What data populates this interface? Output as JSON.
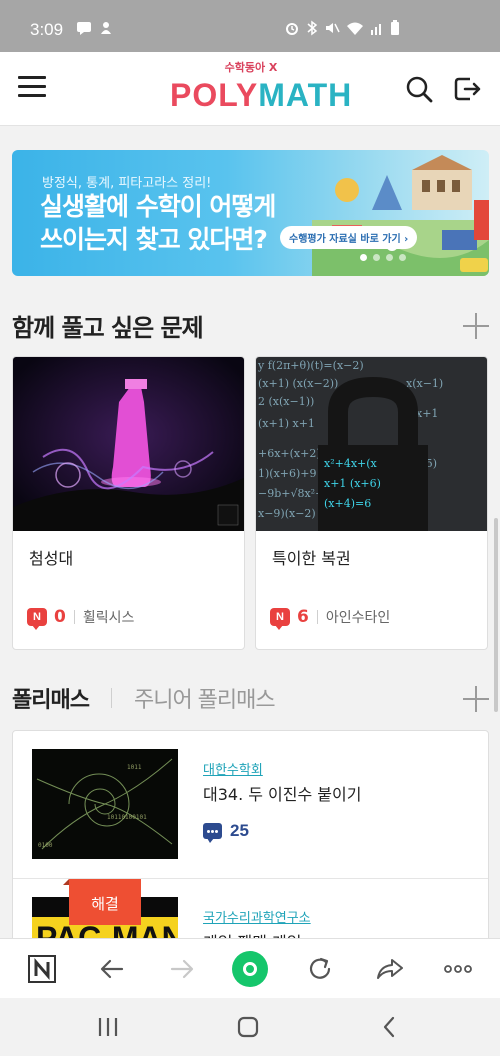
{
  "status_bar": {
    "time": "3:09"
  },
  "header": {
    "logo_sub": "수학동아 X",
    "logo_poly": "POLY",
    "logo_math": "MATH"
  },
  "banner": {
    "kicker": "방정식, 통계, 피타고라스 정리!",
    "title_line1": "실생활에 수학이 어떻게",
    "title_line2": "쓰이는지 찾고 있다면?",
    "button_label": "수행평가 자료실 바로 가기 ›"
  },
  "problems_section": {
    "title": "함께 풀고 싶은 문제",
    "cards": [
      {
        "title": "첨성대",
        "count": "0",
        "author": "휠릭시스",
        "badge": "N"
      },
      {
        "title": "특이한 복권",
        "count": "6",
        "author": "아인수타인",
        "badge": "N"
      }
    ]
  },
  "list_section": {
    "tab_active": "폴리매스",
    "tab_inactive": "주니어 폴리매스",
    "items": [
      {
        "publisher": "대한수학회",
        "title": "대34. 두 이진수 붙이기",
        "comments": "25"
      },
      {
        "publisher": "국가수리과학연구소",
        "title": "게임 팩맨 게임",
        "ribbon": "해결"
      }
    ]
  },
  "colors": {
    "brand_red": "#ea4a5e",
    "brand_teal": "#2ab3c3",
    "accent_red": "#e9413f",
    "comment_blue": "#2d4b8f",
    "home_green": "#15c66b"
  },
  "icons": [
    "menu-icon",
    "search-icon",
    "logout-icon",
    "plus-icon",
    "n-badge-icon",
    "comment-icon",
    "naver-n-icon",
    "back-arrow-icon",
    "forward-arrow-icon",
    "home-icon",
    "refresh-icon",
    "share-icon",
    "more-icon",
    "recent-apps-icon",
    "home-square-icon",
    "nav-back-icon"
  ]
}
